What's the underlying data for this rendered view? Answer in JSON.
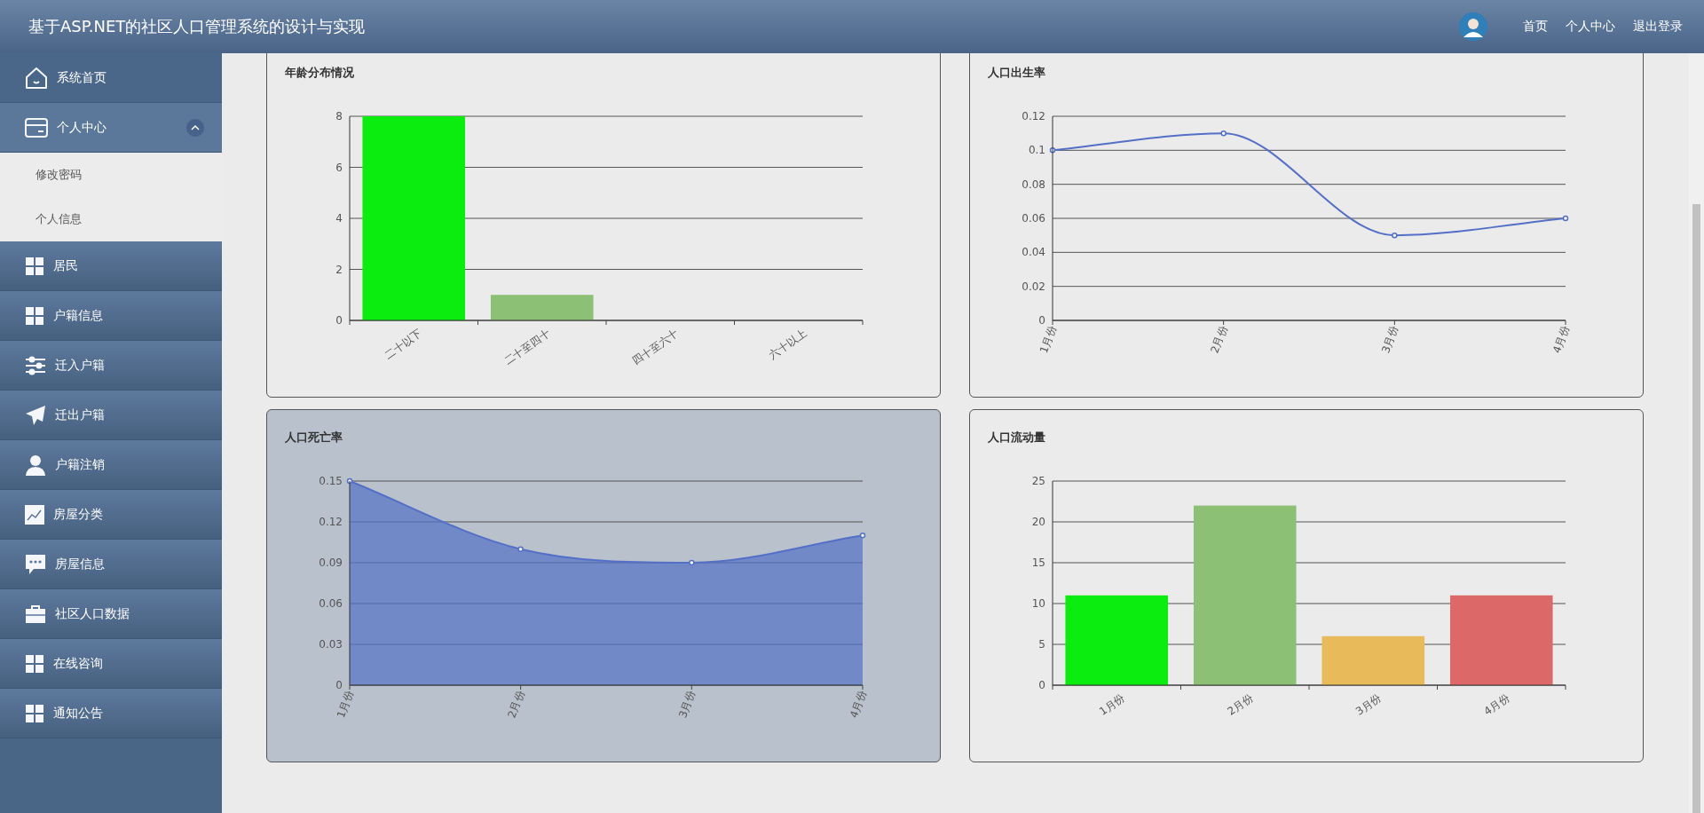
{
  "header": {
    "title": "基于ASP.NET的社区人口管理系统的设计与实现",
    "links": [
      "首页",
      "个人中心",
      "退出登录"
    ]
  },
  "sidebar": {
    "items": [
      {
        "label": "系统首页",
        "expanded": false
      },
      {
        "label": "个人中心",
        "expanded": true,
        "children": [
          {
            "label": "修改密码"
          },
          {
            "label": "个人信息"
          }
        ]
      },
      {
        "label": "居民",
        "expanded": false
      },
      {
        "label": "户籍信息",
        "expanded": false
      },
      {
        "label": "迁入户籍",
        "expanded": false
      },
      {
        "label": "迁出户籍",
        "expanded": false
      },
      {
        "label": "户籍注销",
        "expanded": false
      },
      {
        "label": "房屋分类",
        "expanded": false
      },
      {
        "label": "房屋信息",
        "expanded": false
      },
      {
        "label": "社区人口数据",
        "expanded": false
      },
      {
        "label": "在线咨询",
        "expanded": false
      },
      {
        "label": "通知公告",
        "expanded": false
      }
    ]
  },
  "cards": [
    {
      "hovered": false,
      "chart_data": {
        "type": "bar",
        "title": "年龄分布情况",
        "grid": true,
        "categories": [
          "二十以下",
          "二十至四十",
          "四十至六十",
          "六十以上"
        ],
        "colors": [
          "#0bed0f",
          "#8cc074"
        ],
        "series": [
          {
            "values": [
              8,
              1,
              0,
              0
            ]
          }
        ],
        "ylim": [
          0,
          8
        ],
        "yticks": [
          0,
          2,
          4,
          6,
          8
        ]
      }
    },
    {
      "hovered": false,
      "chart_data": {
        "type": "line",
        "title": "人口出生率",
        "grid": true,
        "categories": [
          "1月份",
          "2月份",
          "3月份",
          "4月份"
        ],
        "series": [
          {
            "color": "#5470c6",
            "marker": true,
            "values": [
              0.1,
              0.11,
              0.05,
              0.06
            ]
          }
        ],
        "ylim": [
          0,
          0.12
        ],
        "yticks": [
          0,
          0.02,
          0.04,
          0.06,
          0.08,
          0.1,
          0.12
        ]
      }
    },
    {
      "hovered": true,
      "chart_data": {
        "type": "area",
        "title": "人口死亡率",
        "grid": true,
        "categories": [
          "1月份",
          "2月份",
          "3月份",
          "4月份"
        ],
        "series": [
          {
            "color": "#5470c6",
            "marker": true,
            "values": [
              0.15,
              0.1,
              0.09,
              0.11
            ]
          }
        ],
        "ylim": [
          0,
          0.15
        ],
        "yticks": [
          0,
          0.03,
          0.06,
          0.09,
          0.12,
          0.15
        ]
      }
    },
    {
      "hovered": false,
      "chart_data": {
        "type": "bar",
        "title": "人口流动量",
        "grid": true,
        "categories": [
          "1月份",
          "2月份",
          "3月份",
          "4月份"
        ],
        "colors": [
          "#0bed0f",
          "#8cc074",
          "#e9ba5a",
          "#dd6868"
        ],
        "series": [
          {
            "values": [
              11,
              22,
              6,
              11
            ]
          }
        ],
        "ylim": [
          0,
          25
        ],
        "yticks": [
          0,
          5,
          10,
          15,
          20,
          25
        ]
      }
    }
  ]
}
